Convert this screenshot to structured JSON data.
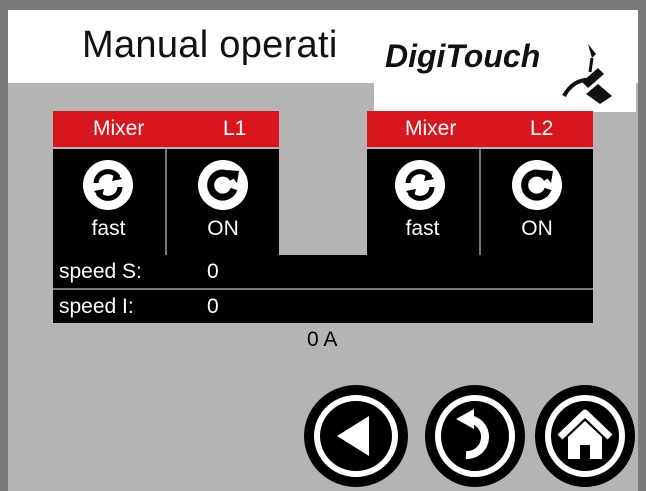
{
  "header": {
    "title": "Manual operati",
    "logo_text": "DigiTouch"
  },
  "mixers": [
    {
      "label": "Mixer",
      "line": "L1",
      "mode_icon": "rotate-arrows-icon",
      "mode": "fast",
      "state_icon": "refresh-icon",
      "state": "ON"
    },
    {
      "label": "Mixer",
      "line": "L2",
      "mode_icon": "rotate-arrows-icon",
      "mode": "fast",
      "state_icon": "refresh-icon",
      "state": "ON"
    }
  ],
  "rows": [
    {
      "label": "speed S:",
      "value": "0"
    },
    {
      "label": "speed I:",
      "value": "0"
    }
  ],
  "current": "0 A",
  "nav": {
    "back_icon": "back-triangle-icon",
    "undo_icon": "undo-arrow-icon",
    "home_icon": "home-icon"
  },
  "colors": {
    "accent_red": "#d7161d",
    "panel_bg": "#b4b4b4"
  }
}
